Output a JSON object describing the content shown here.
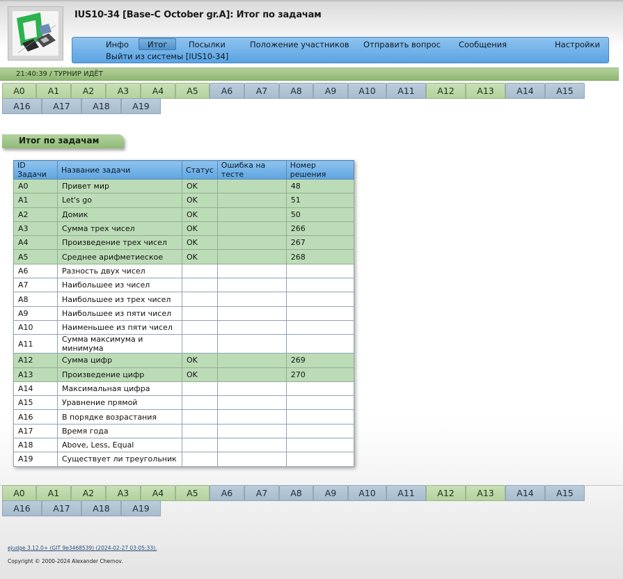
{
  "header": {
    "title": "IUS10-34 [Base-C October gr.A]: Итог по задачам"
  },
  "menu": {
    "items": [
      {
        "label": "Инфо"
      },
      {
        "label": "Итог"
      },
      {
        "label": "Посылки"
      },
      {
        "label": "Положение участников"
      },
      {
        "label": "Отправить вопрос"
      },
      {
        "label": "Сообщения"
      },
      {
        "label": "Настройки"
      },
      {
        "label": "Выйти из системы [IUS10-34]"
      }
    ],
    "active": "Итог"
  },
  "status": {
    "time": "21:40:39",
    "separator": " / ",
    "state": "ТУРНИР ИДЁТ"
  },
  "problem_tabs": [
    {
      "label": "A0",
      "solved": true
    },
    {
      "label": "A1",
      "solved": true
    },
    {
      "label": "A2",
      "solved": true
    },
    {
      "label": "A3",
      "solved": true
    },
    {
      "label": "A4",
      "solved": true
    },
    {
      "label": "A5",
      "solved": true
    },
    {
      "label": "A6",
      "solved": false
    },
    {
      "label": "A7",
      "solved": false
    },
    {
      "label": "A8",
      "solved": false
    },
    {
      "label": "A9",
      "solved": false
    },
    {
      "label": "A10",
      "solved": false
    },
    {
      "label": "A11",
      "solved": false
    },
    {
      "label": "A12",
      "solved": true
    },
    {
      "label": "A13",
      "solved": true
    },
    {
      "label": "A14",
      "solved": false
    },
    {
      "label": "A15",
      "solved": false
    },
    {
      "label": "A16",
      "solved": false
    },
    {
      "label": "A17",
      "solved": false
    },
    {
      "label": "A18",
      "solved": false
    },
    {
      "label": "A19",
      "solved": false
    }
  ],
  "section": {
    "title": "Итог по задачам"
  },
  "table": {
    "columns": [
      "ID Задачи",
      "Название задачи",
      "Статус",
      "Ошибка на тесте",
      "Номер решения"
    ],
    "rows": [
      {
        "id": "A0",
        "name": "Привет мир",
        "status": "OK",
        "failed_test": "",
        "run_id": "48",
        "solved": true
      },
      {
        "id": "A1",
        "name": "Let's go",
        "status": "OK",
        "failed_test": "",
        "run_id": "51",
        "solved": true
      },
      {
        "id": "A2",
        "name": "Домик",
        "status": "OK",
        "failed_test": "",
        "run_id": "50",
        "solved": true
      },
      {
        "id": "A3",
        "name": "Сумма трех чисел",
        "status": "OK",
        "failed_test": "",
        "run_id": "266",
        "solved": true
      },
      {
        "id": "A4",
        "name": "Произведение трех чисел",
        "status": "OK",
        "failed_test": "",
        "run_id": "267",
        "solved": true
      },
      {
        "id": "A5",
        "name": "Среднее арифметиеское",
        "status": "OK",
        "failed_test": "",
        "run_id": "268",
        "solved": true
      },
      {
        "id": "A6",
        "name": "Разность двух чисел",
        "status": "",
        "failed_test": "",
        "run_id": "",
        "solved": false
      },
      {
        "id": "A7",
        "name": "Наибольшее из чисел",
        "status": "",
        "failed_test": "",
        "run_id": "",
        "solved": false
      },
      {
        "id": "A8",
        "name": "Наибольшее из трех чисел",
        "status": "",
        "failed_test": "",
        "run_id": "",
        "solved": false
      },
      {
        "id": "A9",
        "name": "Наибольшее из пяти чисел",
        "status": "",
        "failed_test": "",
        "run_id": "",
        "solved": false
      },
      {
        "id": "A10",
        "name": "Наименьшее из пяти чисел",
        "status": "",
        "failed_test": "",
        "run_id": "",
        "solved": false
      },
      {
        "id": "A11",
        "name": "Сумма максимума и минимума",
        "status": "",
        "failed_test": "",
        "run_id": "",
        "solved": false
      },
      {
        "id": "A12",
        "name": "Сумма цифр",
        "status": "OK",
        "failed_test": "",
        "run_id": "269",
        "solved": true
      },
      {
        "id": "A13",
        "name": "Произведение цифр",
        "status": "OK",
        "failed_test": "",
        "run_id": "270",
        "solved": true
      },
      {
        "id": "A14",
        "name": "Максимальная цифра",
        "status": "",
        "failed_test": "",
        "run_id": "",
        "solved": false
      },
      {
        "id": "A15",
        "name": "Уравнение прямой",
        "status": "",
        "failed_test": "",
        "run_id": "",
        "solved": false
      },
      {
        "id": "A16",
        "name": "В порядке возрастания",
        "status": "",
        "failed_test": "",
        "run_id": "",
        "solved": false
      },
      {
        "id": "A17",
        "name": "Время года",
        "status": "",
        "failed_test": "",
        "run_id": "",
        "solved": false
      },
      {
        "id": "A18",
        "name": "Above, Less, Equal",
        "status": "",
        "failed_test": "",
        "run_id": "",
        "solved": false
      },
      {
        "id": "A19",
        "name": "Существует ли треугольник",
        "status": "",
        "failed_test": "",
        "run_id": "",
        "solved": false
      }
    ]
  },
  "footer": {
    "version_link": "ejudge 3.12.0+ (GIT 9e3468539) (2024-02-27 03:05:33)",
    "version_suffix": ".",
    "copyright": "Copyright © 2000-2024 Alexander Chernov."
  },
  "colors": {
    "menu_blue": "#5aa3e2",
    "solved_green": "#bcdcb7",
    "unsolved_tab": "#a7bccd",
    "status_bar_green": "#8eb873"
  }
}
